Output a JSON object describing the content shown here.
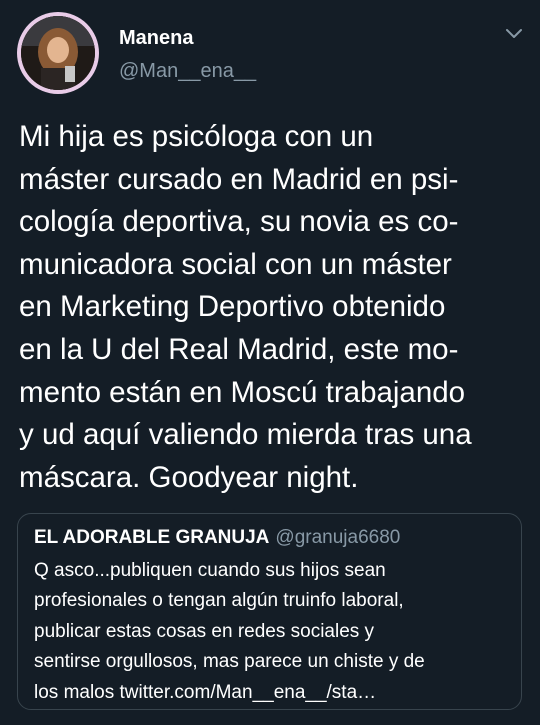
{
  "author": {
    "display_name": "Manena",
    "handle": "@Man__ena__"
  },
  "icons": {
    "menu": "chevron-down-icon",
    "avatar": "profile-photo"
  },
  "colors": {
    "background": "#141d26",
    "secondary_text": "#8899a6",
    "card_border": "#38444d",
    "avatar_ring": "#e9cce8"
  },
  "tweet": {
    "lines": [
      "Mi hija es psicóloga con un",
      "máster cursado en Madrid en psi-",
      "cología deportiva, su novia es co-",
      "municadora social con un máster",
      "en Marketing Deportivo obtenido",
      "en la U del Real Madrid, este mo-",
      "mento están en Moscú trabajando",
      "y ud aquí valiendo mierda tras una",
      "máscara. Goodyear night."
    ]
  },
  "quoted_tweet": {
    "display_name": "EL ADORABLE GRANUJA",
    "handle": "@granuja6680",
    "lines": [
      "Q asco...publiquen cuando sus hijos sean",
      "profesionales o tengan algún truinfo laboral,",
      "publicar estas cosas en redes sociales y",
      "sentirse orgullosos, mas parece un chiste y de",
      "los malos twitter.com/Man__ena__/sta…"
    ]
  }
}
